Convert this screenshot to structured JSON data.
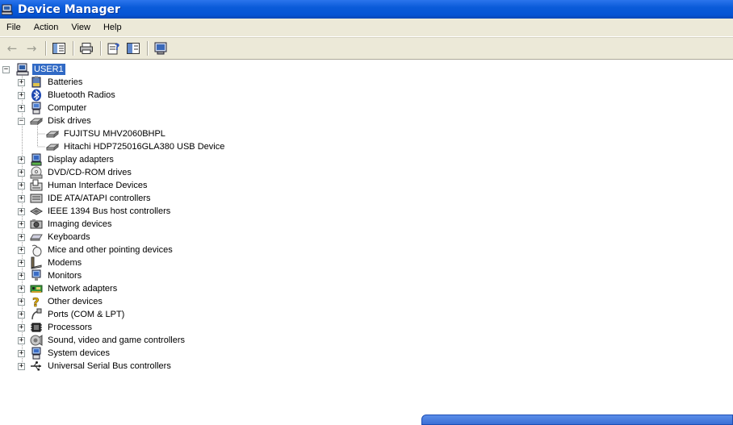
{
  "window": {
    "title": "Device Manager"
  },
  "menu": [
    "File",
    "Action",
    "View",
    "Help"
  ],
  "toolbar": {
    "buttons": [
      "back-icon",
      "forward-icon",
      "show-hide-tree-icon",
      "print-icon",
      "properties-icon",
      "help-icon",
      "scan-hardware-icon"
    ]
  },
  "tree": {
    "root": {
      "label": "USER1",
      "icon": "computer-icon"
    },
    "items": [
      {
        "label": "Batteries",
        "icon": "battery-icon",
        "expanded": false
      },
      {
        "label": "Bluetooth Radios",
        "icon": "bluetooth-icon",
        "expanded": false
      },
      {
        "label": "Computer",
        "icon": "computer-icon",
        "expanded": false
      },
      {
        "label": "Disk drives",
        "icon": "disk-drive-icon",
        "expanded": true,
        "children": [
          {
            "label": "FUJITSU MHV2060BHPL",
            "icon": "disk-drive-icon"
          },
          {
            "label": "Hitachi HDP725016GLA380 USB Device",
            "icon": "disk-drive-icon"
          }
        ]
      },
      {
        "label": "Display adapters",
        "icon": "display-adapter-icon",
        "expanded": false
      },
      {
        "label": "DVD/CD-ROM drives",
        "icon": "cdrom-icon",
        "expanded": false
      },
      {
        "label": "Human Interface Devices",
        "icon": "hid-icon",
        "expanded": false
      },
      {
        "label": "IDE ATA/ATAPI controllers",
        "icon": "ide-controller-icon",
        "expanded": false
      },
      {
        "label": "IEEE 1394 Bus host controllers",
        "icon": "firewire-icon",
        "expanded": false
      },
      {
        "label": "Imaging devices",
        "icon": "camera-icon",
        "expanded": false
      },
      {
        "label": "Keyboards",
        "icon": "keyboard-icon",
        "expanded": false
      },
      {
        "label": "Mice and other pointing devices",
        "icon": "mouse-icon",
        "expanded": false
      },
      {
        "label": "Modems",
        "icon": "modem-icon",
        "expanded": false
      },
      {
        "label": "Monitors",
        "icon": "monitor-icon",
        "expanded": false
      },
      {
        "label": "Network adapters",
        "icon": "network-adapter-icon",
        "expanded": false
      },
      {
        "label": "Other devices",
        "icon": "unknown-device-icon",
        "expanded": false
      },
      {
        "label": "Ports (COM & LPT)",
        "icon": "port-icon",
        "expanded": false
      },
      {
        "label": "Processors",
        "icon": "processor-icon",
        "expanded": false
      },
      {
        "label": "Sound, video and game controllers",
        "icon": "sound-icon",
        "expanded": false
      },
      {
        "label": "System devices",
        "icon": "system-device-icon",
        "expanded": false
      },
      {
        "label": "Universal Serial Bus controllers",
        "icon": "usb-icon",
        "expanded": false
      }
    ]
  },
  "colors": {
    "titlebar": "#0a5bd9",
    "selection": "#316ac5",
    "chrome": "#ece9d8"
  }
}
